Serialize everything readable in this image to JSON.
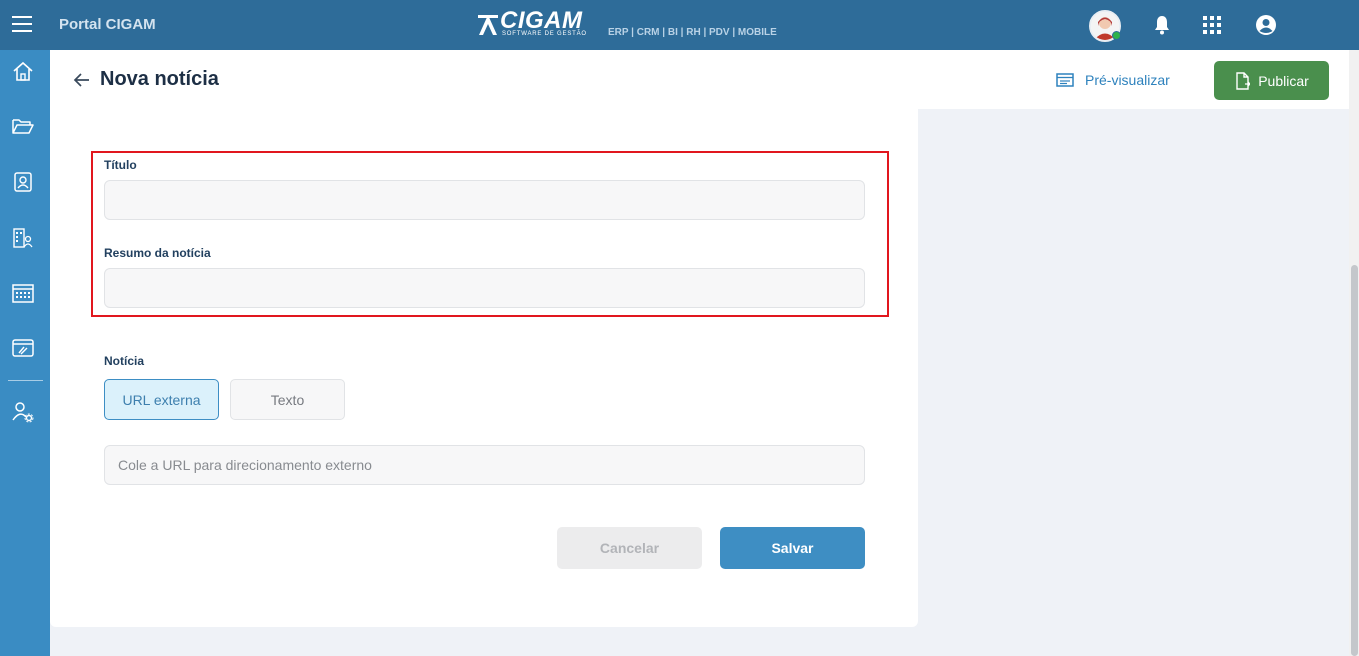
{
  "topbar": {
    "portal_title": "Portal CIGAM",
    "logo_name": "CIGAM",
    "logo_subtitle": "SOFTWARE DE GESTÃO",
    "logo_products": "ERP | CRM | BI | RH | PDV | MOBILE"
  },
  "sidebar": {
    "items": [
      "home-icon",
      "folder-icon",
      "contacts-icon",
      "org-icon",
      "calendar-icon",
      "tickets-icon",
      "user-settings-icon"
    ]
  },
  "header": {
    "title": "Nova notícia",
    "preview_label": "Pré-visualizar",
    "publish_label": "Publicar"
  },
  "form": {
    "title_label": "Título",
    "title_value": "",
    "summary_label": "Resumo da notícia",
    "summary_value": "",
    "news_label": "Notícia",
    "segments": [
      "URL externa",
      "Texto"
    ],
    "selected_segment": "URL externa",
    "url_placeholder": "Cole a URL para direcionamento externo",
    "cancel_label": "Cancelar",
    "save_label": "Salvar"
  },
  "colors": {
    "topbar": "#2e6c99",
    "sidebar": "#3a8cc3",
    "publish": "#4a8f4d",
    "save": "#3e8ec3",
    "highlight": "#e1171e"
  }
}
